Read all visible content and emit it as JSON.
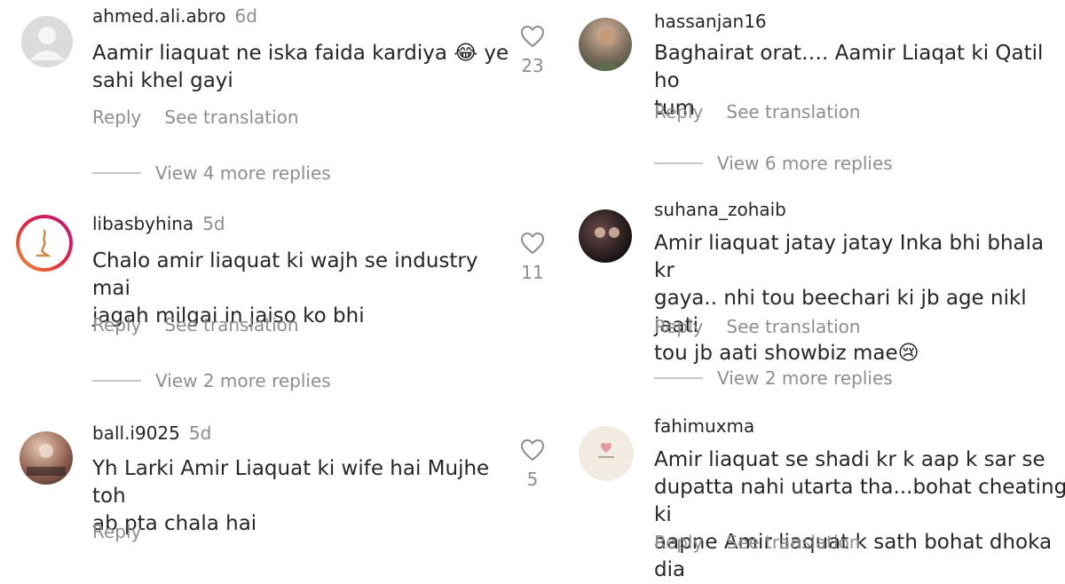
{
  "left_comments": [
    {
      "username": "ahmed.ali.abro",
      "time": "6d",
      "text_line1": "Aamir liaquat ne iska faida kardiya 😂 ye",
      "text_line2": "sahi khel gayi",
      "reply_label": "Reply",
      "translate_label": "See translation",
      "view_more": "View 4 more replies",
      "likes": "23",
      "avatar_icon": "default-avatar-icon"
    },
    {
      "username": "libasbyhina",
      "time": "5d",
      "text_line1": "Chalo amir liaquat ki wajh se industry mai",
      "text_line2": "jagah milgai in jaiso ko bhi",
      "reply_label": "Reply",
      "translate_label": "See translation",
      "view_more": "View 2 more replies",
      "likes": "11",
      "avatar_icon": "brand-logo-avatar"
    },
    {
      "username": "ball.i9025",
      "time": "5d",
      "text_line1": "Yh Larki Amir Liaquat ki wife hai Mujhe toh",
      "text_line2": "ab pta chala hai",
      "reply_label": "Reply",
      "likes": "5",
      "avatar_icon": "photo-avatar"
    }
  ],
  "right_comments": [
    {
      "username": "hassanjan16",
      "text_line1": "Baghairat orat…. Aamir Liaqat ki Qatil ho",
      "text_line2": "tum",
      "reply_label": "Reply",
      "translate_label": "See translation",
      "view_more": "View 6 more replies",
      "avatar_icon": "photo-avatar"
    },
    {
      "username": "suhana_zohaib",
      "text_line1": "Amir liaquat jatay jatay Inka bhi bhala kr",
      "text_line2": "gaya.. nhi tou beechari ki jb age nikl jaati",
      "text_line3": "tou jb aati showbiz mae😢",
      "reply_label": "Reply",
      "translate_label": "See translation",
      "view_more": "View 2 more replies",
      "avatar_icon": "photo-avatar"
    },
    {
      "username": "fahimuxma",
      "text_line1": "Amir liaquat se shadi kr k aap k sar se",
      "text_line2": "dupatta nahi utarta tha...bohat cheating ki",
      "text_line3": "aapne Amir liaquat k sath bohat dhoka dia",
      "reply_label": "Reply",
      "translate_label": "See translation",
      "avatar_icon": "heart-sticker-avatar"
    }
  ],
  "colors": {
    "text": "#262626",
    "secondary": "#8e8e8e",
    "divider": "#c7c7c7",
    "ring_gradient_start": "#f09433",
    "ring_gradient_end": "#bc1888"
  }
}
